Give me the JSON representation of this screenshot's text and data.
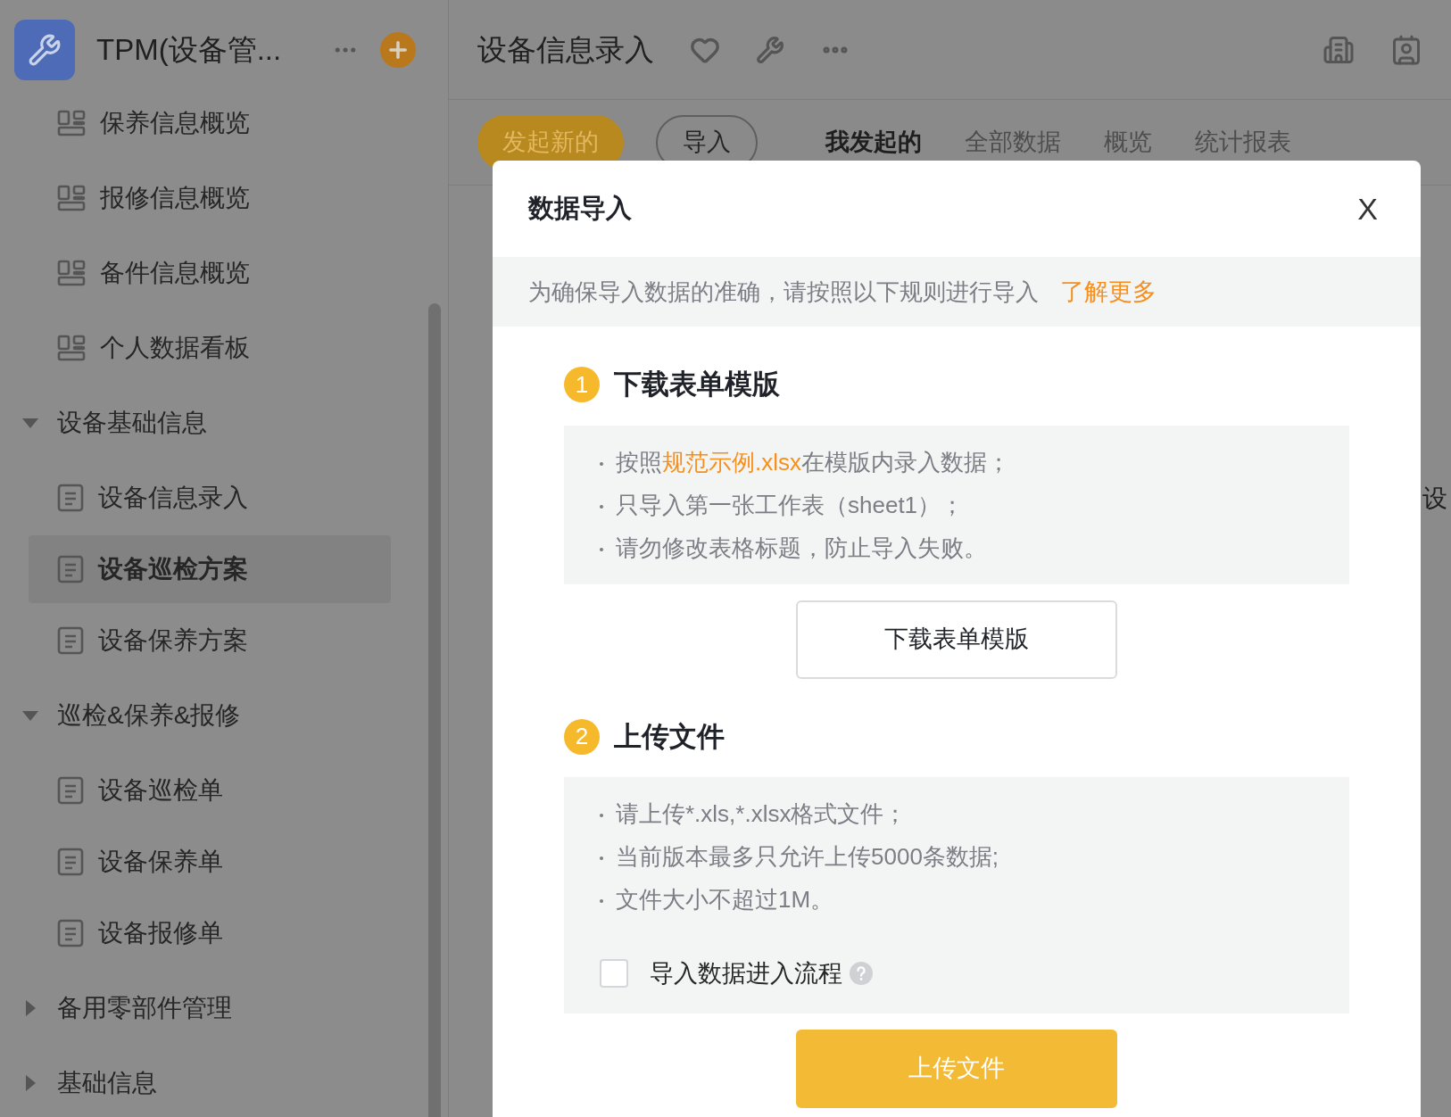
{
  "app": {
    "title": "TPM(设备管..."
  },
  "sidebar": {
    "items": [
      {
        "kind": "dashboard",
        "label": "保养信息概览",
        "selected": false
      },
      {
        "kind": "dashboard",
        "label": "报修信息概览",
        "selected": false
      },
      {
        "kind": "dashboard",
        "label": "备件信息概览",
        "selected": false
      },
      {
        "kind": "dashboard",
        "label": "个人数据看板",
        "selected": false
      },
      {
        "kind": "group",
        "label": "设备基础信息",
        "expanded": true,
        "children": [
          {
            "kind": "form",
            "label": "设备信息录入",
            "selected": false
          },
          {
            "kind": "form",
            "label": "设备巡检方案",
            "selected": true
          },
          {
            "kind": "form",
            "label": "设备保养方案",
            "selected": false
          }
        ]
      },
      {
        "kind": "group",
        "label": "巡检&保养&报修",
        "expanded": true,
        "children": [
          {
            "kind": "form",
            "label": "设备巡检单",
            "selected": false
          },
          {
            "kind": "form",
            "label": "设备保养单",
            "selected": false
          },
          {
            "kind": "form",
            "label": "设备报修单",
            "selected": false
          }
        ]
      },
      {
        "kind": "group",
        "label": "备用零部件管理",
        "expanded": false
      },
      {
        "kind": "group",
        "label": "基础信息",
        "expanded": false
      }
    ]
  },
  "page": {
    "title": "设备信息录入",
    "actions": [
      {
        "kind": "primary",
        "label": "发起新的"
      },
      {
        "kind": "outline",
        "label": "导入"
      }
    ],
    "tabs": [
      {
        "label": "我发起的",
        "selected": true
      },
      {
        "label": "全部数据",
        "selected": false
      },
      {
        "label": "概览",
        "selected": false
      },
      {
        "label": "统计报表",
        "selected": false
      }
    ],
    "partial_text": "设"
  },
  "dialog": {
    "title": "数据导入",
    "close": "X",
    "notice": "为确保导入数据的准确，请按照以下规则进行导入",
    "notice_link": "了解更多",
    "steps": [
      {
        "number": "1",
        "title": "下载表单模版",
        "rules": [
          {
            "before": "按照",
            "link": "规范示例.xlsx",
            "after": "在模版内录入数据；"
          },
          {
            "before": "只导入第一张工作表（sheet1）；"
          },
          {
            "before": "请勿修改表格标题，防止导入失败。"
          }
        ],
        "button": {
          "kind": "outline",
          "label": "下载表单模版"
        }
      },
      {
        "number": "2",
        "title": "上传文件",
        "rules": [
          {
            "before": "请上传*.xls,*.xlsx格式文件；"
          },
          {
            "before": "当前版本最多只允许上传5000条数据;"
          },
          {
            "before": "文件大小不超过1M。"
          }
        ],
        "checkbox": {
          "label": "导入数据进入流程",
          "checked": false
        },
        "button": {
          "kind": "primary",
          "label": "上传文件"
        }
      }
    ]
  }
}
